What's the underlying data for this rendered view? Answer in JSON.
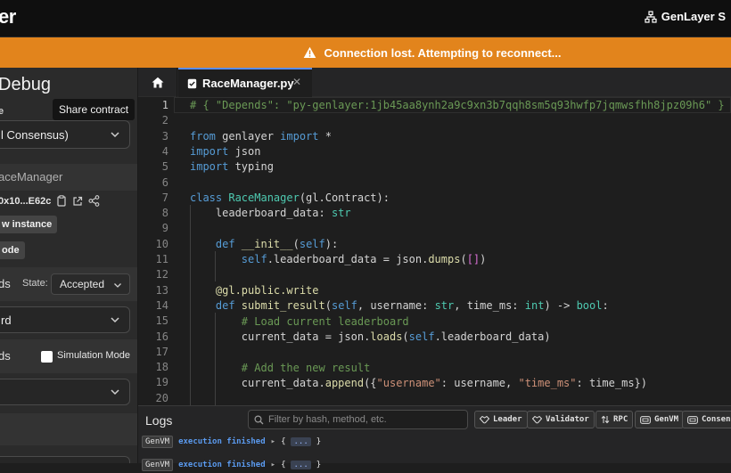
{
  "topbar": {
    "logo": "er",
    "brand": "GenLayer S"
  },
  "banner": {
    "text": "Connection lost. Attempting to reconnect..."
  },
  "sidebar": {
    "title": "Debug",
    "exec_label": "e",
    "exec_mode": "l Consensus)",
    "contract_name": "aceManager",
    "tooltip": "Share contract",
    "address": "0x10...E62c",
    "new_instance": "w instance",
    "code_btn": "ode",
    "methods_label": "ds",
    "state_label": "State:",
    "state_value": "Accepted",
    "method_select": "rd",
    "write_label": "ds",
    "simulation_label": "Simulation Mode"
  },
  "editor": {
    "tab_name": "RaceManager.py",
    "lines": [
      {
        "n": "1"
      },
      {
        "n": "2"
      },
      {
        "n": "3"
      },
      {
        "n": "4"
      },
      {
        "n": "5"
      },
      {
        "n": "6"
      },
      {
        "n": "7"
      },
      {
        "n": "8"
      },
      {
        "n": "9"
      },
      {
        "n": "10"
      },
      {
        "n": "11"
      },
      {
        "n": "12"
      },
      {
        "n": "13"
      },
      {
        "n": "14"
      },
      {
        "n": "15"
      },
      {
        "n": "16"
      },
      {
        "n": "17"
      },
      {
        "n": "18"
      },
      {
        "n": "19"
      },
      {
        "n": "20"
      }
    ],
    "code": {
      "l1": "# { \"Depends\": \"py-genlayer:1jb45aa8ynh2a9c9xn3b7qqh8sm5q93hwfp7jqmwsfhh8jpz09h6\" }",
      "l3_kw": "from",
      "l3_mod": " genlayer ",
      "l3_kw2": "import",
      "l3_rest": " *",
      "l4_kw": "import",
      "l4_rest": " json",
      "l5_kw": "import",
      "l5_rest": " typing",
      "l7_kw": "class",
      "l7_name": " RaceManager",
      "l7_rest": "(gl.Contract):",
      "l8_a": "    leaderboard_data: ",
      "l8_ty": "str",
      "l10_kw": "    def",
      "l10_fn": " __init__",
      "l10_p1": "(",
      "l10_self": "self",
      "l10_p2": "):",
      "l11_self": "        self",
      "l11_a": ".leaderboard_data = json.",
      "l11_fn": "dumps",
      "l11_b": "(",
      "l11_br": "[]",
      "l11_c": ")",
      "l13": "    @gl.public.write",
      "l14_kw": "    def",
      "l14_fn": " submit_result",
      "l14_a": "(",
      "l14_self": "self",
      "l14_b": ", username: ",
      "l14_ty1": "str",
      "l14_c": ", time_ms: ",
      "l14_ty2": "int",
      "l14_d": ") -> ",
      "l14_ty3": "bool",
      "l14_e": ":",
      "l15": "        # Load current leaderboard",
      "l16_a": "        current_data = json.",
      "l16_fn": "loads",
      "l16_b": "(",
      "l16_self": "self",
      "l16_c": ".leaderboard_data)",
      "l18": "        # Add the new result",
      "l19_a": "        current_data.",
      "l19_fn": "append",
      "l19_b": "({",
      "l19_s1": "\"username\"",
      "l19_c": ": username, ",
      "l19_s2": "\"time_ms\"",
      "l19_d": ": time_ms})"
    }
  },
  "logs": {
    "title": "Logs",
    "filter_placeholder": "Filter by hash, method, etc.",
    "chips": [
      "Leader",
      "Validator",
      "RPC",
      "GenVM",
      "Consens"
    ],
    "rows": [
      {
        "tag": "GenVM",
        "msg": "execution finished",
        "arrow": "▸",
        "obj_open": "{",
        "dots": "...",
        "obj_close": "}"
      },
      {
        "tag": "GenVM",
        "msg": "execution finished",
        "arrow": "▸",
        "obj_open": "{",
        "dots": "...",
        "obj_close": "}"
      }
    ]
  },
  "colors": {
    "banner": "#e2841c",
    "accent_tab": "#5b8def",
    "log_msg": "#5b9bf0"
  }
}
